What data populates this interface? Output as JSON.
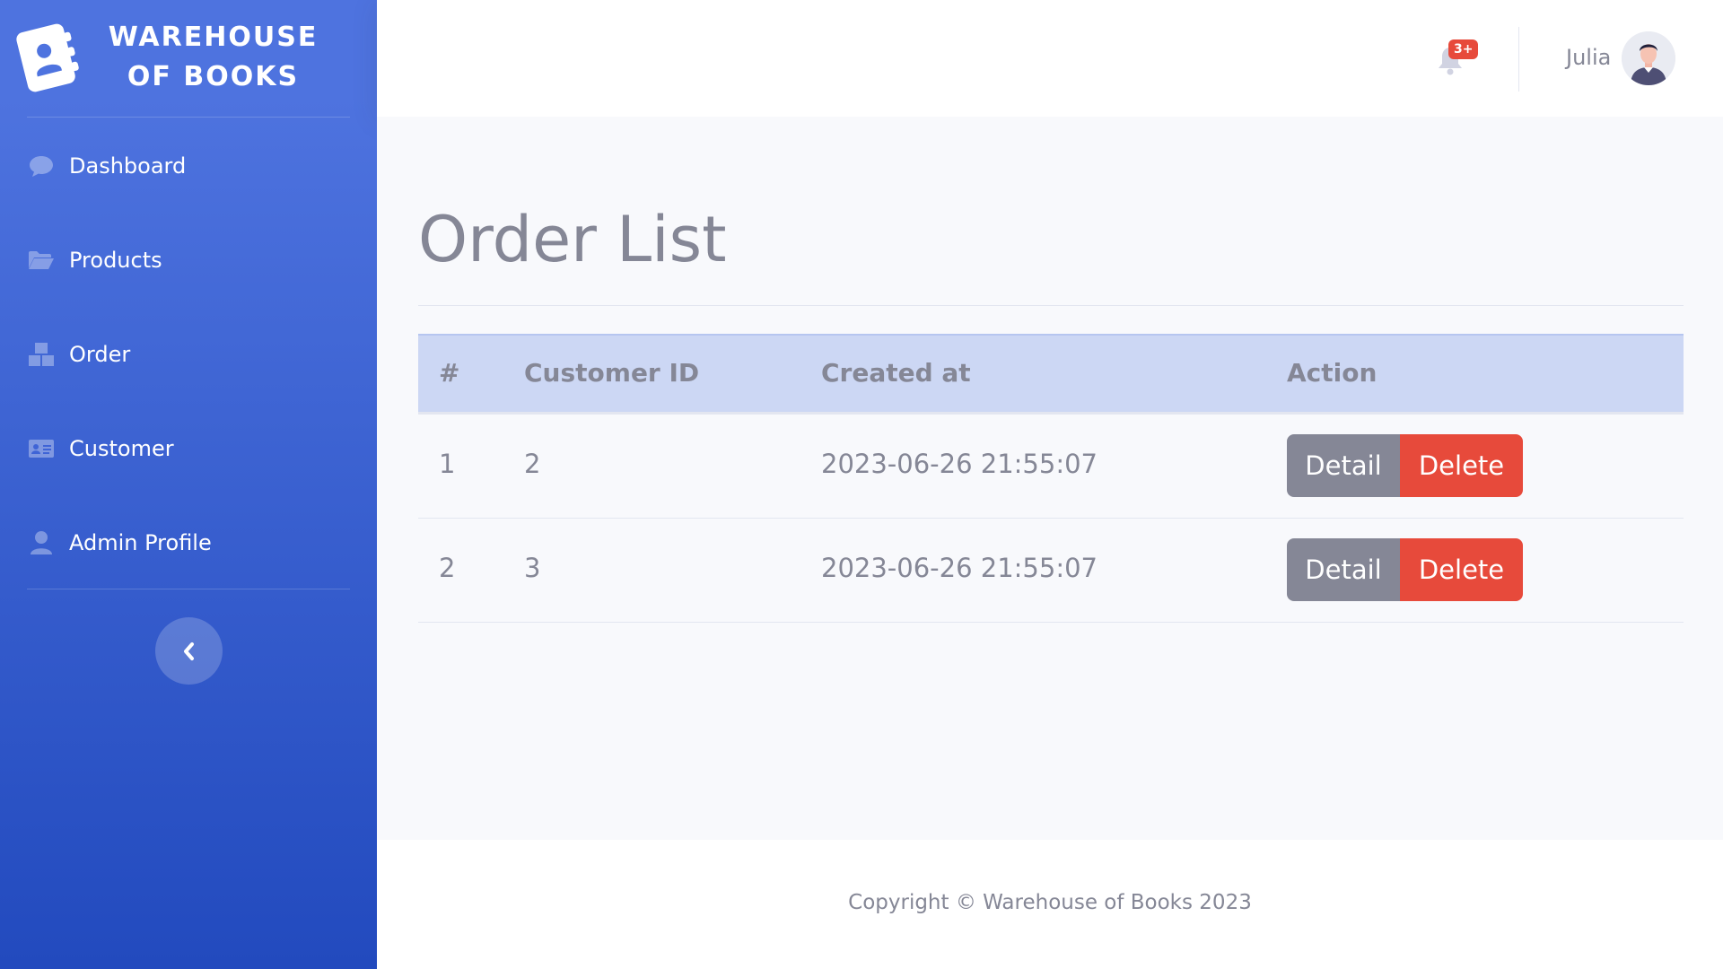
{
  "brand": {
    "line1": "WAREHOUSE",
    "line2": "OF BOOKS"
  },
  "sidebar": {
    "items": [
      {
        "label": "Dashboard",
        "icon": "comment-icon"
      },
      {
        "label": "Products",
        "icon": "folder-open-icon"
      },
      {
        "label": "Order",
        "icon": "boxes-icon"
      },
      {
        "label": "Customer",
        "icon": "id-card-icon"
      },
      {
        "label": "Admin Profile",
        "icon": "user-icon"
      }
    ],
    "toggle_icon": "chevron-left-icon"
  },
  "topbar": {
    "notification_badge": "3+",
    "user_name": "Julia"
  },
  "page": {
    "title": "Order List"
  },
  "table": {
    "headers": [
      "#",
      "Customer ID",
      "Created at",
      "Action"
    ],
    "rows": [
      {
        "num": "1",
        "customer_id": "2",
        "created_at": "2023-06-26 21:55:07"
      },
      {
        "num": "2",
        "customer_id": "3",
        "created_at": "2023-06-26 21:55:07"
      }
    ],
    "detail_label": "Detail",
    "delete_label": "Delete"
  },
  "footer": {
    "copyright": "Copyright © Warehouse of Books 2023"
  },
  "colors": {
    "primary": "#4e73df",
    "danger": "#e74a3b",
    "secondary": "#858796",
    "table_header": "#ccd7f4"
  }
}
